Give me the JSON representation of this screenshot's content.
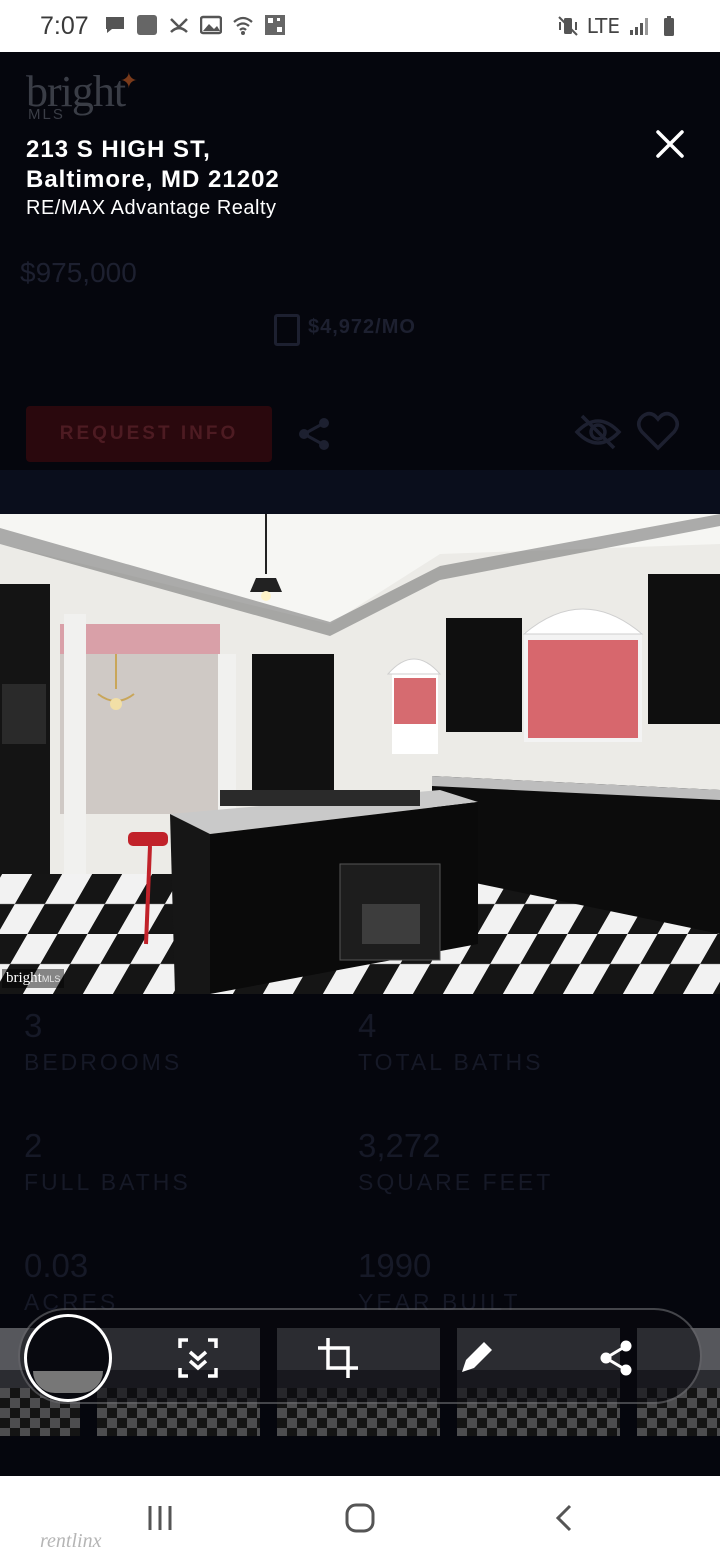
{
  "status_bar": {
    "time": "7:07",
    "network": "LTE",
    "left_icons": [
      "message-icon",
      "app-icon",
      "missed-call-icon",
      "gallery-icon",
      "wifi-calling-icon",
      "qr-icon"
    ],
    "right_icons": [
      "mute-vibrate-icon",
      "signal-icon",
      "battery-icon"
    ]
  },
  "background_page": {
    "logo": "bright",
    "logo_sub": "MLS",
    "price": "$975,000",
    "monthly": "$4,972/MO",
    "request_button": "REQUEST INFO",
    "stats": [
      {
        "value": "3",
        "label": "BEDROOMS"
      },
      {
        "value": "4",
        "label": "TOTAL BATHS"
      },
      {
        "value": "2",
        "label": "FULL BATHS"
      },
      {
        "value": "3,272",
        "label": "SQUARE FEET"
      },
      {
        "value": "0.03",
        "label": "ACRES"
      },
      {
        "value": "1990",
        "label": "YEAR BUILT"
      }
    ]
  },
  "viewer": {
    "address_line1": "213 S HIGH ST,",
    "address_line2": "Baltimore, MD 21202",
    "broker": "RE/MAX Advantage Realty",
    "photo_watermark": "bright",
    "photo_watermark_sub": "MLS"
  },
  "screenshot_toolbar": {
    "buttons": [
      "scroll-capture-icon",
      "crop-icon",
      "edit-pencil-icon",
      "share-icon"
    ]
  },
  "nav_bar": {
    "buttons": [
      "recents-icon",
      "home-icon",
      "back-icon"
    ],
    "watermark": "rentlinx"
  },
  "colors": {
    "overlay_background": "#05060d",
    "request_button_dim": "#2a080d",
    "white": "#ffffff"
  }
}
